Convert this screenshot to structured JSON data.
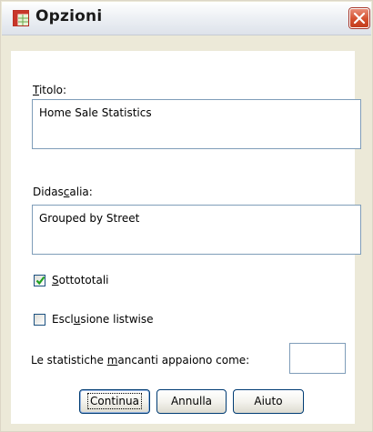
{
  "window": {
    "title": "Opzioni",
    "close_icon": "close-x-icon",
    "app_icon": "table-grid-icon"
  },
  "title_field": {
    "label": "Titolo:",
    "mnemonic": "T",
    "value": "Home Sale Statistics"
  },
  "caption_field": {
    "label_before": "Didas",
    "label_mnemonic": "c",
    "label_after": "alia:",
    "value": "Grouped by Street"
  },
  "subtotals": {
    "mnemonic": "S",
    "label_rest": "ottototali",
    "checked": true
  },
  "listwise": {
    "label_before": "Escl",
    "mnemonic": "u",
    "label_after": "sione listwise",
    "checked": false
  },
  "missing_stats": {
    "label_before": "Le statistiche ",
    "mnemonic": "m",
    "label_after": "ancanti appaiono come:",
    "value": ""
  },
  "buttons": {
    "continue": "Continua",
    "cancel": "Annulla",
    "help": "Aiuto"
  },
  "colors": {
    "window_bg": "#ece9d8",
    "close_button": "#d4502f",
    "input_border": "#7f9db9",
    "checkbox_border": "#1c5180"
  }
}
